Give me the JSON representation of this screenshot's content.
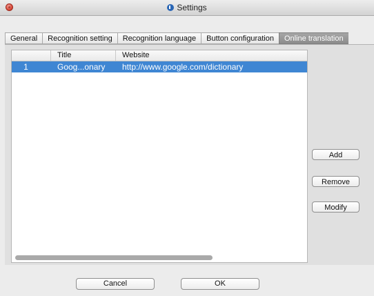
{
  "window": {
    "title": "Settings"
  },
  "tabs": [
    {
      "label": "General"
    },
    {
      "label": "Recognition setting"
    },
    {
      "label": "Recognition language"
    },
    {
      "label": "Button configuration"
    },
    {
      "label": "Online translation"
    }
  ],
  "table": {
    "columns": [
      "",
      "Title",
      "Website"
    ],
    "rows": [
      {
        "num": "1",
        "title": "Goog...onary",
        "website": "http://www.google.com/dictionary"
      }
    ]
  },
  "side_buttons": {
    "add": "Add",
    "remove": "Remove",
    "modify": "Modify"
  },
  "footer": {
    "cancel": "Cancel",
    "ok": "OK"
  }
}
